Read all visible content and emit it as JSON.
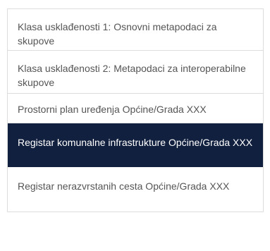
{
  "list": {
    "items": [
      {
        "label": "Klasa usklađenosti 1: Osnovni metapodaci za skupove",
        "active": false
      },
      {
        "label": "Klasa usklađenosti 2: Metapodaci za interoperabilne skupove",
        "active": false
      },
      {
        "label": "Prostorni plan uređenja Općine/Grada XXX",
        "active": false
      },
      {
        "label": "Registar komunalne infrastrukture Općine/Grada XXX",
        "active": true
      },
      {
        "label": "Registar nerazvrstanih cesta Općine/Grada XXX",
        "active": false
      }
    ],
    "colors": {
      "active_background": "#12203f",
      "active_text": "#ffffff",
      "text": "#555555",
      "border": "#dddddd"
    }
  }
}
